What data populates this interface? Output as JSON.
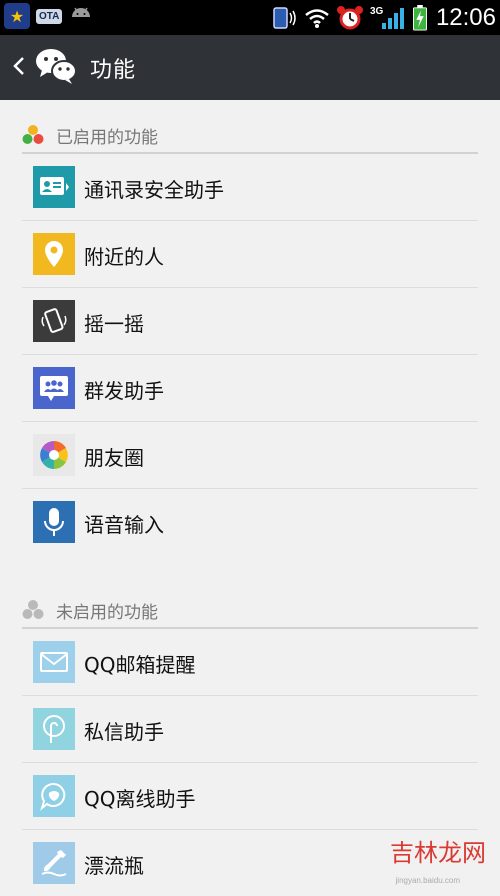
{
  "status_bar": {
    "time": "12:06",
    "ota_label": "OTA",
    "network_label": "3G"
  },
  "header": {
    "title": "功能"
  },
  "enabled_section": {
    "title": "已启用的功能",
    "items": [
      {
        "label": "通讯录安全助手",
        "icon": "contacts-security-icon",
        "color": "#1f9aa8"
      },
      {
        "label": "附近的人",
        "icon": "location-pin-icon",
        "color": "#f2b820"
      },
      {
        "label": "摇一摇",
        "icon": "shake-phone-icon",
        "color": "#3b3b3b"
      },
      {
        "label": "群发助手",
        "icon": "group-message-icon",
        "color": "#4a66cc"
      },
      {
        "label": "朋友圈",
        "icon": "moments-icon",
        "color": "#e8e8e8"
      },
      {
        "label": "语音输入",
        "icon": "microphone-icon",
        "color": "#2c6fb3"
      }
    ]
  },
  "disabled_section": {
    "title": "未启用的功能",
    "items": [
      {
        "label": "QQ邮箱提醒",
        "icon": "mail-icon",
        "color": "#9dd0ea"
      },
      {
        "label": "私信助手",
        "icon": "private-message-icon",
        "color": "#8fd4de"
      },
      {
        "label": "QQ离线助手",
        "icon": "qq-offline-icon",
        "color": "#8fd0e6"
      },
      {
        "label": "漂流瓶",
        "icon": "drift-bottle-icon",
        "color": "#9fcbe8"
      }
    ]
  },
  "watermark": {
    "text": "吉林龙网",
    "url_text": "jingyan.baidu.com"
  }
}
